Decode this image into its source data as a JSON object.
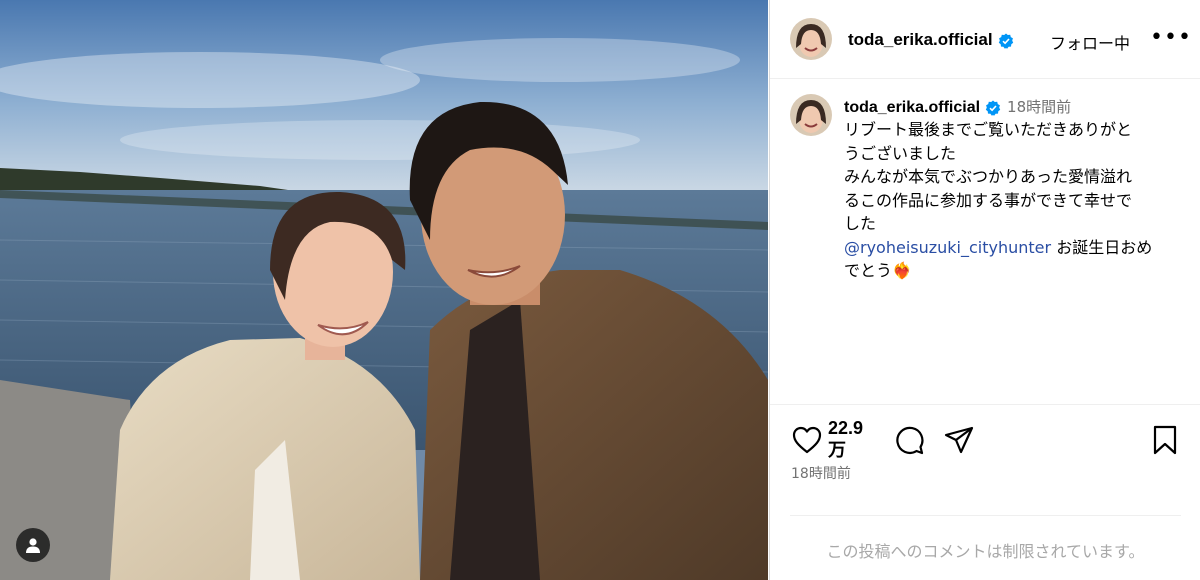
{
  "post": {
    "image_description_icon": "photo",
    "tag_icon": "user-icon"
  },
  "header": {
    "username": "toda_erika.official",
    "verified_icon": "verified-badge-icon",
    "follow_status": "フォロー中",
    "more_label": "•••"
  },
  "caption": {
    "username": "toda_erika.official",
    "timestamp": "18時間前",
    "line1": "リブート最後までご覧いただきありがと",
    "line2": "うございました",
    "line3": "みんなが本気でぶつかりあった愛情溢れ",
    "line4": "るこの作品に参加する事ができて幸せで",
    "line5": "した",
    "mention": "@ryoheisuzuki_cityhunter",
    "line6_suffix": "お誕生日おめ",
    "line7": "でとう",
    "emoji": "❤️‍🔥"
  },
  "actions": {
    "like_count_line1": "22.9",
    "like_count_line2": "万",
    "post_time": "18時間前",
    "icons": [
      "heart-icon",
      "comment-icon",
      "share-icon",
      "bookmark-icon"
    ]
  },
  "comments": {
    "disabled_text": "この投稿へのコメントは制限されています。"
  },
  "colors": {
    "verified": "#0095f6",
    "mention": "#2a4ea4",
    "secondary_text": "#737373"
  }
}
